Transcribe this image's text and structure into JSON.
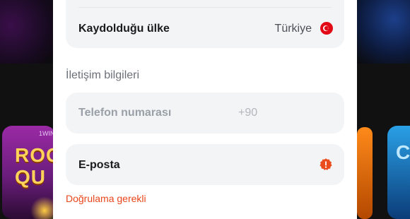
{
  "background": {
    "left_game": {
      "badge": "1WIN",
      "title_line1": "ROC",
      "title_line2": "QU"
    },
    "right_game": {
      "title": "C"
    }
  },
  "form": {
    "country": {
      "label": "Kaydolduğu ülke",
      "value": "Türkiye",
      "flag_icon": "turkey-flag-icon"
    },
    "contact_section_title": "İletişim bilgileri",
    "phone": {
      "label": "Telefon numarası",
      "prefix": "+90"
    },
    "email": {
      "label": "E-posta",
      "status_icon": "warning-badge-icon",
      "hint": "Doğrulama gerekli"
    }
  },
  "colors": {
    "accent_warning": "#e8451a",
    "turkey_red": "#e30a17",
    "panel_bg": "#ffffff",
    "field_bg": "#f3f4f6"
  }
}
